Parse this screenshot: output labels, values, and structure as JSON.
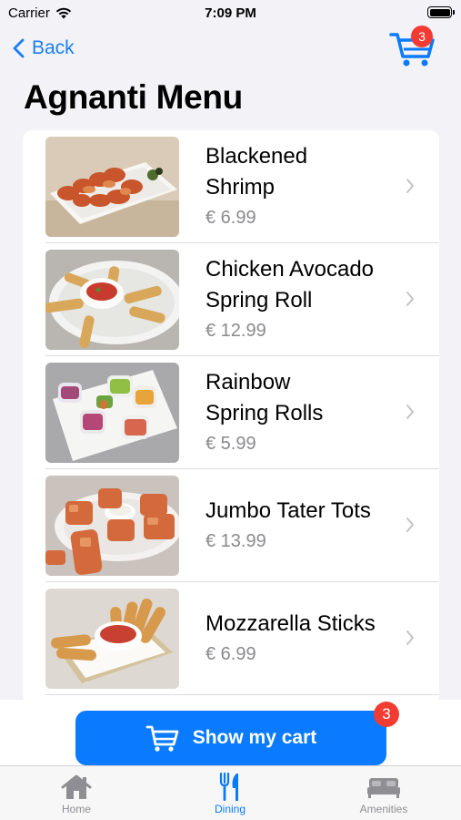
{
  "status": {
    "carrier": "Carrier",
    "time": "7:09 PM"
  },
  "nav": {
    "back_label": "Back",
    "cart_count": "3"
  },
  "title": "Agnanti Menu",
  "menu": [
    {
      "name_line1": "Blackened",
      "name_line2": "Shrimp",
      "price": "€ 6.99"
    },
    {
      "name_line1": "Chicken Avocado",
      "name_line2": "Spring Roll",
      "price": "€ 12.99"
    },
    {
      "name_line1": "Rainbow",
      "name_line2": "Spring Rolls",
      "price": "€ 5.99"
    },
    {
      "name_line1": "Jumbo Tater Tots",
      "name_line2": "",
      "price": "€ 13.99"
    },
    {
      "name_line1": "Mozzarella Sticks",
      "name_line2": "",
      "price": "€ 6.99"
    }
  ],
  "cart_button": {
    "label": "Show my cart",
    "count": "3"
  },
  "tabs": [
    {
      "label": "Home",
      "icon": "house-icon"
    },
    {
      "label": "Dining",
      "icon": "fork-knife-icon",
      "active": true
    },
    {
      "label": "Amenities",
      "icon": "bed-icon"
    }
  ],
  "colors": {
    "accent": "#0a7bff",
    "badge": "#f23c33",
    "price": "#8a8a8e"
  }
}
